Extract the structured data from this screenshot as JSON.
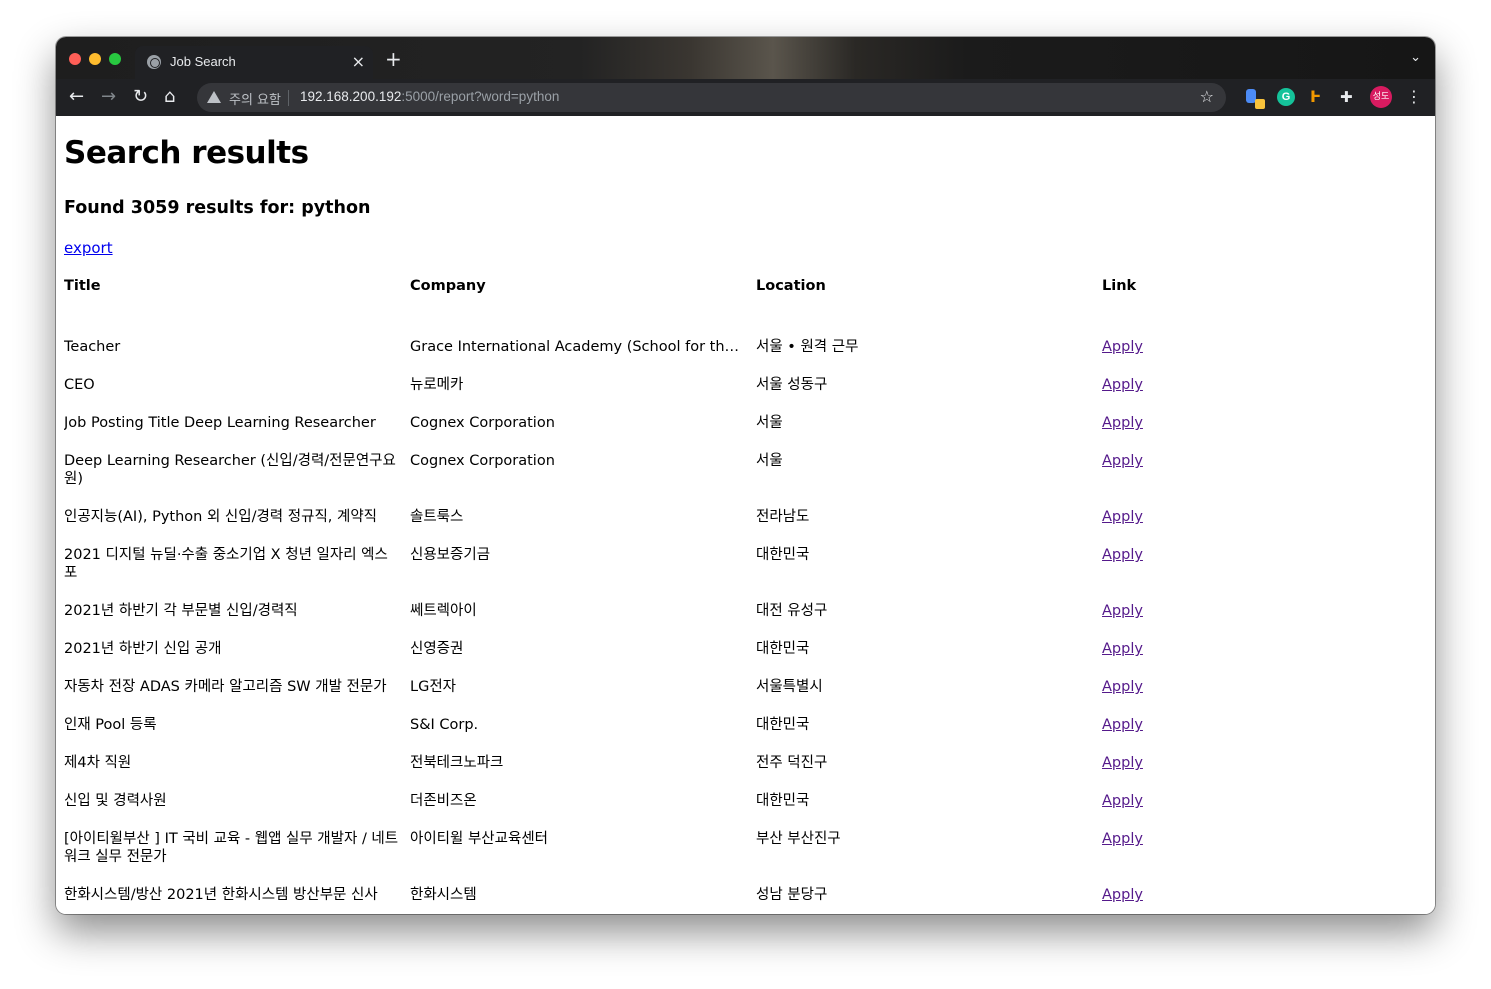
{
  "browser": {
    "tab_title": "Job Search",
    "tab_close": "×",
    "new_tab": "+",
    "tabstrip_menu": "⌄",
    "security_label": "주의 요함",
    "url_host": "192.168.200.192",
    "url_rest": ":5000/report?word=python",
    "avatar_text": "성도"
  },
  "page": {
    "heading": "Search results",
    "summary": "Found 3059 results for: python",
    "export_label": "export"
  },
  "table": {
    "headers": [
      "Title",
      "Company",
      "Location",
      "Link"
    ],
    "rows": [
      {
        "title": "Teacher",
        "company": "Grace International Academy (School for the...",
        "location": "서울 • 원격 근무",
        "link": "Apply",
        "visited": true
      },
      {
        "title": "CEO",
        "company": "뉴로메카",
        "location": "서울 성동구",
        "link": "Apply",
        "visited": true
      },
      {
        "title": "Job Posting Title Deep Learning Researcher",
        "company": "Cognex Corporation",
        "location": "서울",
        "link": "Apply",
        "visited": true
      },
      {
        "title": "Deep Learning Researcher (신입/경력/전문연구요원)",
        "company": "Cognex Corporation",
        "location": "서울",
        "link": "Apply",
        "visited": true
      },
      {
        "title": "인공지능(AI), Python 외 신입/경력 정규직, 계약직",
        "company": "솔트룩스",
        "location": "전라남도",
        "link": "Apply",
        "visited": true
      },
      {
        "title": "2021 디지털 뉴딜·수출 중소기업 X 청년 일자리 엑스포",
        "company": "신용보증기금",
        "location": "대한민국",
        "link": "Apply",
        "visited": true
      },
      {
        "title": "2021년 하반기 각 부문별 신입/경력직",
        "company": "쎄트렉아이",
        "location": "대전 유성구",
        "link": "Apply",
        "visited": true
      },
      {
        "title": "2021년 하반기 신입 공개",
        "company": "신영증권",
        "location": "대한민국",
        "link": "Apply",
        "visited": true
      },
      {
        "title": "자동차 전장 ADAS 카메라 알고리즘 SW 개발 전문가",
        "company": "LG전자",
        "location": "서울특별시",
        "link": "Apply",
        "visited": true
      },
      {
        "title": "인재 Pool 등록",
        "company": "S&I Corp.",
        "location": "대한민국",
        "link": "Apply",
        "visited": true
      },
      {
        "title": "제4차 직원",
        "company": "전북테크노파크",
        "location": "전주 덕진구",
        "link": "Apply",
        "visited": true
      },
      {
        "title": "신입 및 경력사원",
        "company": "더존비즈온",
        "location": "대한민국",
        "link": "Apply",
        "visited": true
      },
      {
        "title": "[아이티윌부산 ] IT 국비 교육 - 웹앱 실무 개발자 / 네트워크 실무 전문가",
        "company": "아이티윌 부산교육센터",
        "location": "부산 부산진구",
        "link": "Apply",
        "visited": true
      },
      {
        "title": "한화시스템/방산 2021년 한화시스템 방산부문 신사",
        "company": "한화시스템",
        "location": "성남 분당구",
        "link": "Apply",
        "visited": true
      }
    ]
  }
}
